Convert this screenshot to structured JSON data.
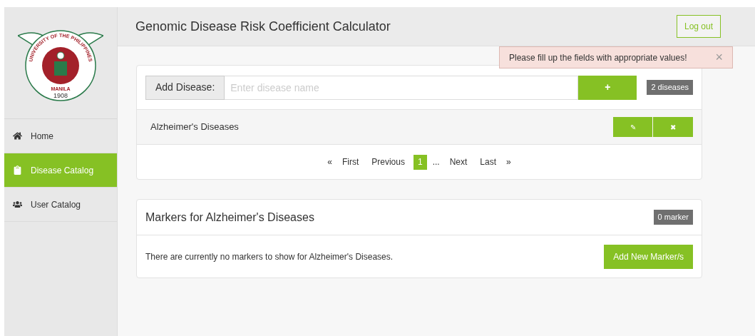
{
  "logo": {
    "ring_top": "UNIVERSITY OF THE PHILIPPINES",
    "ring_bottom": "MANILA",
    "year": "1908"
  },
  "sidebar": {
    "items": [
      {
        "label": "Home",
        "selected": false
      },
      {
        "label": "Disease Catalog",
        "selected": true
      },
      {
        "label": "User Catalog",
        "selected": false
      }
    ]
  },
  "header": {
    "title": "Genomic Disease Risk Coefficient Calculator",
    "logout": "Log out"
  },
  "alert": {
    "message": "Please fill up the fields with appropriate values!",
    "close": "×"
  },
  "disease_panel": {
    "add_label": "Add Disease:",
    "placeholder": "Enter disease name",
    "add_button": "+",
    "count_badge": "2 diseases",
    "diseases": [
      {
        "name": "Alzheimer's Diseases",
        "edit": "✎",
        "delete": "✖"
      }
    ],
    "pagination": [
      {
        "label": "«",
        "kind": "arrow",
        "selected": false
      },
      {
        "label": "First",
        "kind": "link",
        "selected": false
      },
      {
        "label": "Previous",
        "kind": "link",
        "selected": false
      },
      {
        "label": "1",
        "kind": "page",
        "selected": true
      },
      {
        "label": "...",
        "kind": "gap",
        "selected": false
      },
      {
        "label": "Next",
        "kind": "link",
        "selected": false
      },
      {
        "label": "Last",
        "kind": "link",
        "selected": false
      },
      {
        "label": "»",
        "kind": "arrow",
        "selected": false
      }
    ]
  },
  "markers_panel": {
    "title": "Markers for Alzheimer's Diseases",
    "count_badge": "0 marker",
    "message": "There are currently no markers to show for Alzheimer's Diseases.",
    "add_button": "Add New Marker/s"
  }
}
